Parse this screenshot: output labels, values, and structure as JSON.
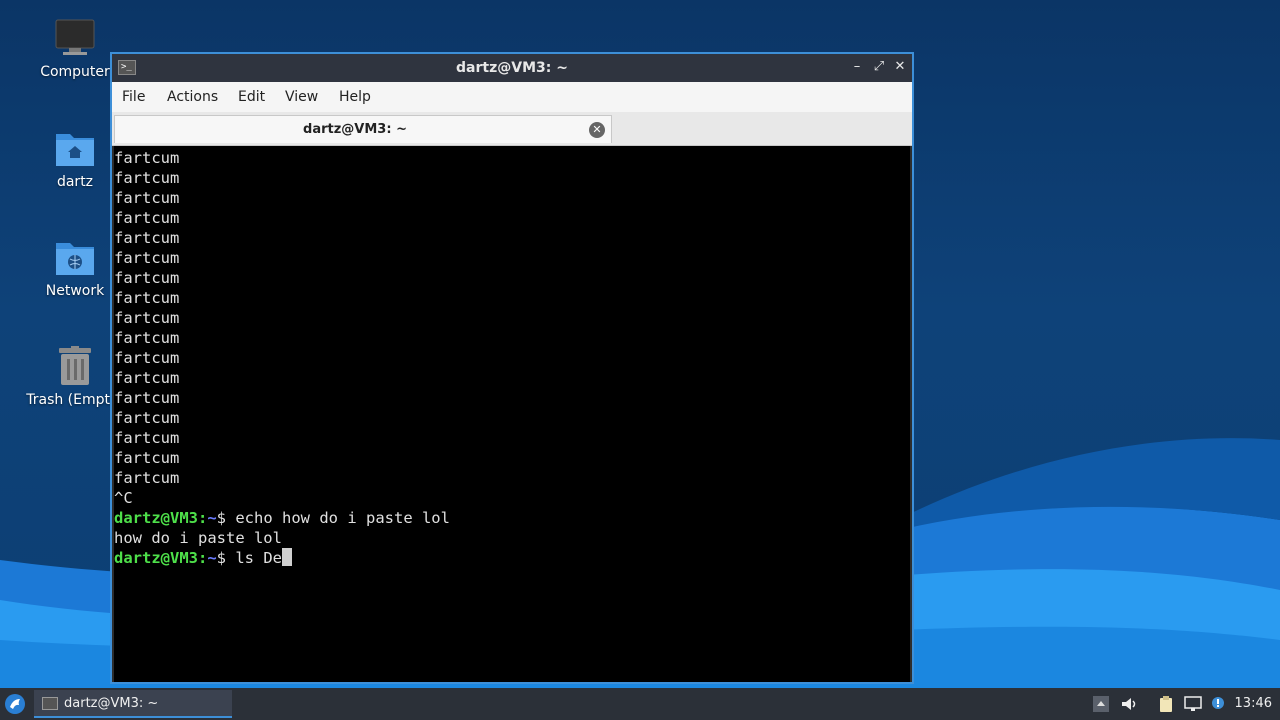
{
  "desktop": {
    "icons": [
      {
        "label": "Computer",
        "icon": "computer-icon"
      },
      {
        "label": "dartz",
        "icon": "home-folder-icon"
      },
      {
        "label": "Network",
        "icon": "network-folder-icon"
      },
      {
        "label": "Trash (Empty)",
        "icon": "trash-icon"
      }
    ]
  },
  "window": {
    "title": "dartz@VM3: ~",
    "controls": {
      "minimize": "–",
      "maximize": "⤢",
      "close": "✕"
    },
    "menu": [
      "File",
      "Actions",
      "Edit",
      "View",
      "Help"
    ],
    "tab": {
      "label": "dartz@VM3: ~",
      "close": "✕"
    }
  },
  "terminal": {
    "output_lines": [
      "fartcum",
      "fartcum",
      "fartcum",
      "fartcum",
      "fartcum",
      "fartcum",
      "fartcum",
      "fartcum",
      "fartcum",
      "fartcum",
      "fartcum",
      "fartcum",
      "fartcum",
      "fartcum",
      "fartcum",
      "fartcum",
      "fartcum",
      "^C"
    ],
    "prompt_user": "dartz@VM3:",
    "prompt_path": "~",
    "prompt_symbol": "$ ",
    "command1": "echo how do i paste lol",
    "output1": "how do i paste lol",
    "command2": "ls De"
  },
  "taskbar": {
    "task_label": "dartz@VM3: ~",
    "clock": "13:46",
    "accent": "#3d8fd8"
  }
}
